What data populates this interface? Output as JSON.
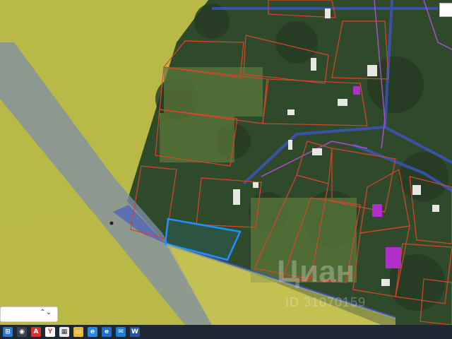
{
  "map": {
    "layers": {
      "field_color": "#c7c24a",
      "forest_color": "#2f4a2a",
      "parcel_outline_color": "#d9442b",
      "highlight_parcel_color": "#1e90ff",
      "zone_band_color": "#7f8fa8",
      "boundary_line_color": "#3c55c8",
      "building_color": "#b02fc8"
    }
  },
  "watermark": {
    "text": "Циан",
    "id_text": "ID 31070159"
  },
  "selector": {
    "value": ""
  },
  "taskbar": {
    "icons": [
      "start-icon",
      "search-icon",
      "pdf-icon",
      "yandex-icon",
      "calendar-icon",
      "folder-icon",
      "edge-icon",
      "ie-icon",
      "mail-icon",
      "word-icon"
    ]
  }
}
